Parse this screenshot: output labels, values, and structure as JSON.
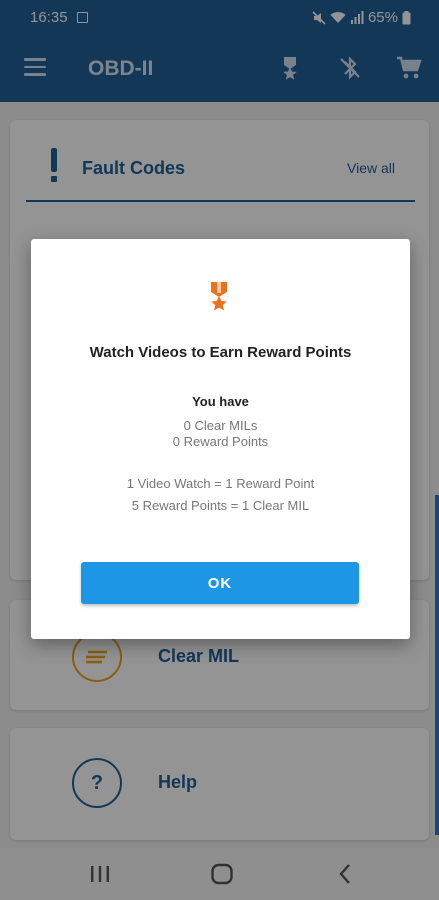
{
  "status_bar": {
    "time": "16:35",
    "battery_percent": "65%",
    "icons": [
      "image-icon",
      "mute-icon",
      "wifi-icon",
      "signal-icon",
      "battery-icon"
    ]
  },
  "app_bar": {
    "title": "OBD-II",
    "actions": [
      "reward-medal-icon",
      "bluetooth-disabled-icon",
      "shopping-cart-icon"
    ]
  },
  "fault_codes_card": {
    "title": "Fault Codes",
    "view_all": "View all"
  },
  "clear_mil_card": {
    "label": "Clear MIL"
  },
  "help_card": {
    "label": "Help",
    "icon_glyph": "?"
  },
  "dialog": {
    "title": "Watch Videos to Earn Reward Points",
    "you_have": "You have",
    "clear_mils": "0 Clear MILs",
    "reward_points": "0 Reward Points",
    "rule_video": "1 Video Watch = 1 Reward Point",
    "rule_points": "5 Reward Points = 1 Clear MIL",
    "ok_label": "OK"
  },
  "colors": {
    "primary": "#1f5f96",
    "accent_button": "#1e96e6",
    "medal": "#e8731c",
    "clear_mil_ring": "#f0a020"
  }
}
